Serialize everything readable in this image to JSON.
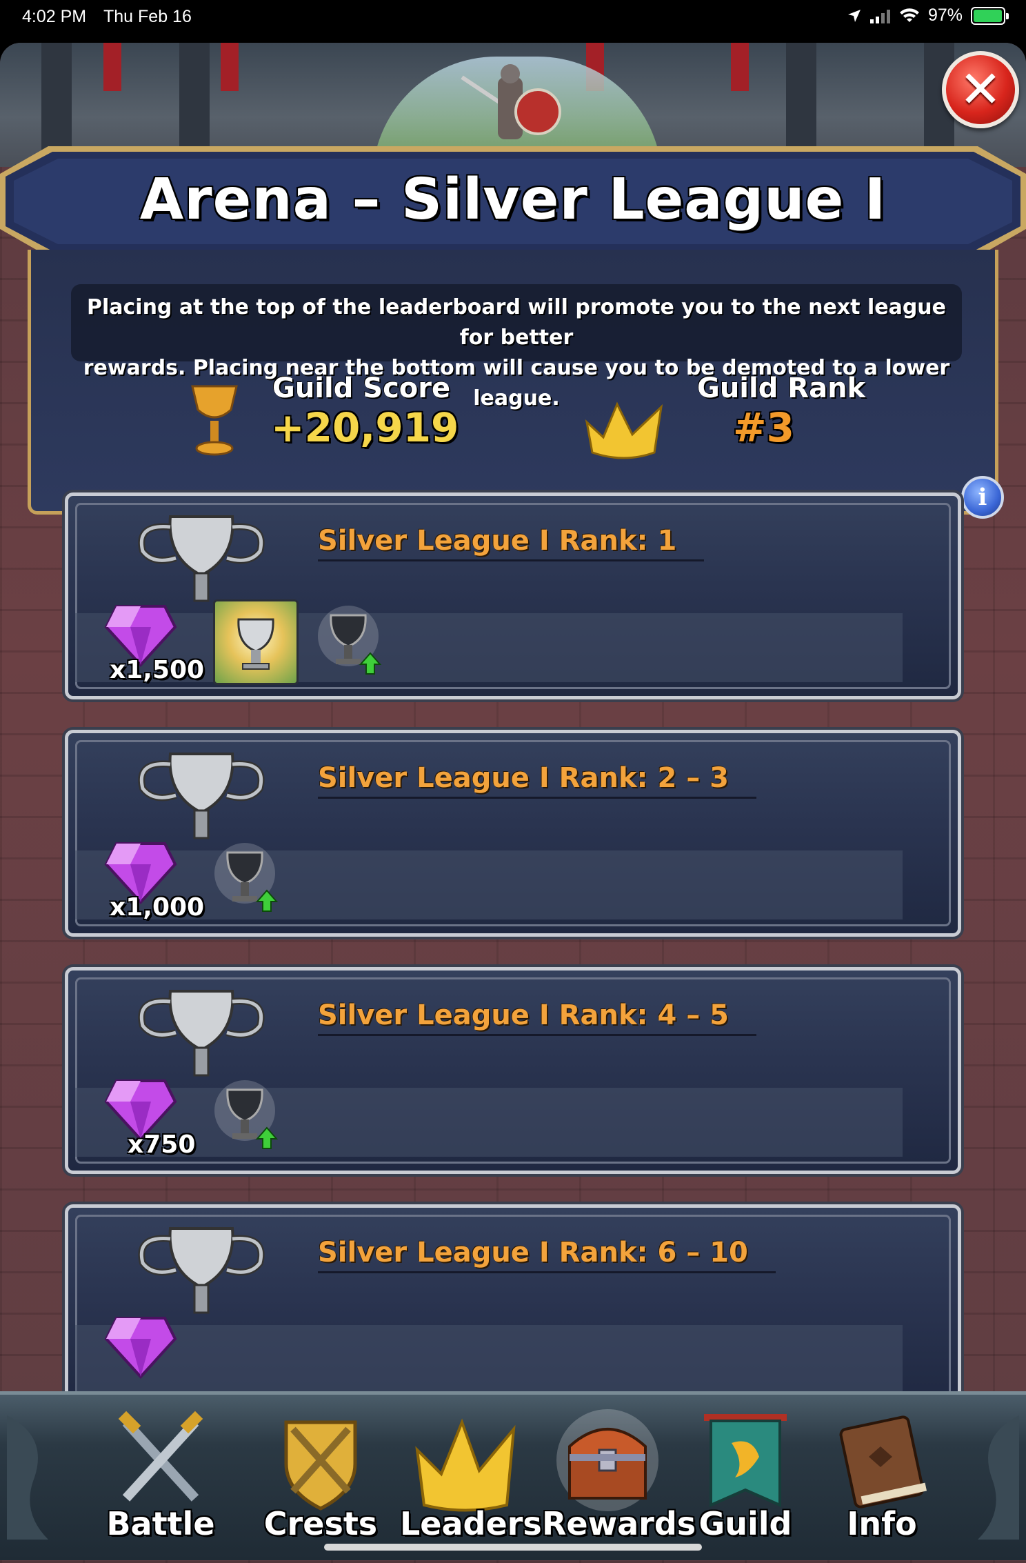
{
  "status_bar": {
    "time": "4:02 PM",
    "date": "Thu Feb 16",
    "battery_percent": "97%",
    "battery_level": 0.97
  },
  "header": {
    "title": "Arena – Silver League I",
    "close_icon": "close-icon"
  },
  "info": {
    "description_line1": "Placing at the top of the leaderboard will promote you to the next league for better",
    "description_line2": "rewards. Placing near the bottom will cause you to be demoted to a lower league.",
    "guild_score_label": "Guild Score",
    "guild_score_value": "+20,919",
    "guild_rank_label": "Guild Rank",
    "guild_rank_value": "#3",
    "info_button_glyph": "i"
  },
  "rewards": [
    {
      "title": "Silver League I Rank: 1",
      "gem_count": "x1,500",
      "has_bonus_tile": true
    },
    {
      "title": "Silver League I Rank: 2 – 3",
      "gem_count": "x1,000",
      "has_bonus_tile": false
    },
    {
      "title": "Silver League I Rank: 4 – 5",
      "gem_count": "x750",
      "has_bonus_tile": false
    },
    {
      "title": "Silver League I Rank: 6 – 10",
      "gem_count": "",
      "has_bonus_tile": false
    }
  ],
  "nav": {
    "battle": "Battle",
    "crests": "Crests",
    "leaders": "Leaders",
    "rewards": "Rewards",
    "guild": "Guild",
    "info": "Info",
    "active": "rewards"
  },
  "colors": {
    "score_gold": "#f5d64a",
    "rank_orange": "#f39a2a",
    "card_title_orange": "#f3a33c",
    "gem_purple": "#b23be0"
  }
}
